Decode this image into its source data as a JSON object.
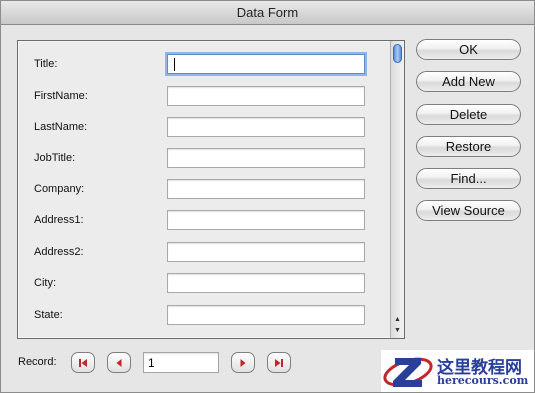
{
  "window": {
    "title": "Data Form"
  },
  "fields": [
    {
      "label": "Title:",
      "value": "",
      "focused": true
    },
    {
      "label": "FirstName:",
      "value": ""
    },
    {
      "label": "LastName:",
      "value": ""
    },
    {
      "label": "JobTitle:",
      "value": ""
    },
    {
      "label": "Company:",
      "value": ""
    },
    {
      "label": "Address1:",
      "value": ""
    },
    {
      "label": "Address2:",
      "value": ""
    },
    {
      "label": "City:",
      "value": ""
    },
    {
      "label": "State:",
      "value": ""
    }
  ],
  "buttons": {
    "ok": "OK",
    "add_new": "Add New",
    "delete": "Delete",
    "restore": "Restore",
    "find": "Find...",
    "view_source": "View Source"
  },
  "record": {
    "label": "Record:",
    "value": "1"
  },
  "icons": {
    "first": "first-record-icon",
    "prev": "previous-record-icon",
    "next": "next-record-icon",
    "last": "last-record-icon",
    "scroll_up": "scroll-up-arrow-icon",
    "scroll_down": "scroll-down-arrow-icon"
  },
  "watermark": {
    "brand": "这里教程网",
    "url": "herecours.com"
  },
  "colors": {
    "accent": "#5b8fd8",
    "nav_arrow": "#c0262c",
    "watermark": "#2a3f9a"
  }
}
